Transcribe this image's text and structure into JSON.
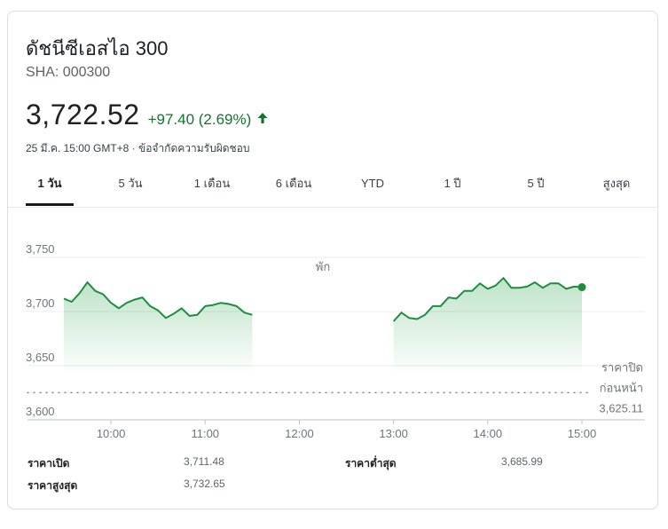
{
  "header": {
    "title": "ดัชนีซีเอสไอ 300",
    "ticker": "SHA: 000300",
    "price": "3,722.52",
    "change": "+97.40 (2.69%)",
    "change_color": "#137333",
    "arrow_icon": "arrow-up-icon",
    "meta_time": "25 มี.ค. 15:00 GMT+8",
    "meta_sep": " · ",
    "meta_disclaimer": "ข้อจำกัดความรับผิดชอบ"
  },
  "tabs": [
    {
      "label": "1 วัน",
      "active": true
    },
    {
      "label": "5 วัน",
      "active": false
    },
    {
      "label": "1 เดือน",
      "active": false
    },
    {
      "label": "6 เดือน",
      "active": false
    },
    {
      "label": "YTD",
      "active": false
    },
    {
      "label": "1 ปี",
      "active": false
    },
    {
      "label": "5 ปี",
      "active": false
    },
    {
      "label": "สูงสุด",
      "active": false
    }
  ],
  "chart_data": {
    "type": "line",
    "title": "",
    "xlabel": "",
    "ylabel": "",
    "ylim": [
      3600,
      3750
    ],
    "xlim": [
      "09:30",
      "15:00"
    ],
    "y_ticks": [
      "3,750",
      "3,700",
      "3,650",
      "3,600"
    ],
    "y_tick_values": [
      3750,
      3700,
      3650,
      3600
    ],
    "x_ticks": [
      "10:00",
      "11:00",
      "12:00",
      "13:00",
      "14:00",
      "15:00"
    ],
    "x_tick_minutes": [
      600,
      660,
      720,
      780,
      840,
      900
    ],
    "grid": true,
    "line_color": "#1e8e3e",
    "fill_color": "#34a853",
    "break_label": "พัก",
    "previous_close": {
      "label_line1": "ราคาปิด",
      "label_line2": "ก่อนหน้า",
      "value_text": "3,625.11",
      "value": 3625.11
    },
    "series": [
      {
        "segment": "morning",
        "x": [
          "09:30",
          "09:35",
          "09:40",
          "09:45",
          "09:50",
          "09:55",
          "10:00",
          "10:05",
          "10:10",
          "10:15",
          "10:20",
          "10:25",
          "10:30",
          "10:35",
          "10:40",
          "10:45",
          "10:50",
          "10:55",
          "11:00",
          "11:05",
          "11:10",
          "11:15",
          "11:20",
          "11:25",
          "11:30"
        ],
        "values": [
          3712,
          3709,
          3717,
          3727,
          3719,
          3716,
          3708,
          3703,
          3708,
          3711,
          3713,
          3705,
          3701,
          3694,
          3698,
          3703,
          3696,
          3697,
          3705,
          3706,
          3708,
          3707,
          3705,
          3699,
          3697
        ]
      },
      {
        "segment": "afternoon",
        "x": [
          "13:00",
          "13:05",
          "13:10",
          "13:15",
          "13:20",
          "13:25",
          "13:30",
          "13:35",
          "13:40",
          "13:45",
          "13:50",
          "13:55",
          "14:00",
          "14:05",
          "14:10",
          "14:15",
          "14:20",
          "14:25",
          "14:30",
          "14:35",
          "14:40",
          "14:45",
          "14:50",
          "14:55",
          "15:00"
        ],
        "values": [
          3691,
          3699,
          3694,
          3693,
          3697,
          3705,
          3705,
          3713,
          3712,
          3719,
          3719,
          3726,
          3721,
          3724,
          3731,
          3722,
          3722,
          3723,
          3727,
          3722,
          3726,
          3726,
          3721,
          3723,
          3722.52
        ]
      }
    ]
  },
  "stats": [
    {
      "label": "ราคาเปิด",
      "value": "3,711.48"
    },
    {
      "label": "ราคาต่ำสุด",
      "value": "3,685.99"
    },
    {
      "label": "ราคาสูงสุด",
      "value": "3,732.65"
    }
  ]
}
